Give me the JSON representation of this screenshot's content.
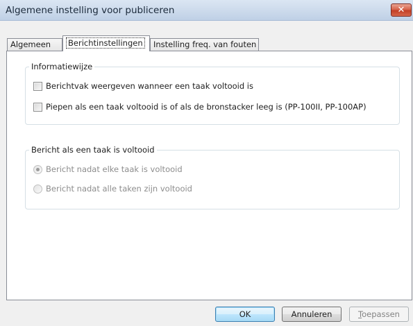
{
  "window": {
    "title": "Algemene instelling voor publiceren",
    "close_glyph": "✕"
  },
  "tabs": [
    {
      "label": "Algemeen",
      "active": false
    },
    {
      "label": "Berichtinstellingen",
      "active": true
    },
    {
      "label": "Instelling freq. van fouten",
      "active": false
    }
  ],
  "group_info": {
    "legend": "Informatiewijze",
    "options": [
      {
        "label": "Berichtvak weergeven wanneer een taak voltooid is",
        "checked": false
      },
      {
        "label": "Piepen als een taak voltooid is of als de bronstacker leeg is (PP-100II, PP-100AP)",
        "checked": false
      }
    ]
  },
  "group_message": {
    "legend": "Bericht als een taak is voltooid",
    "options": [
      {
        "label": "Bericht nadat elke taak is voltooid",
        "selected": true,
        "enabled": false
      },
      {
        "label": "Bericht nadat alle taken zijn voltooid",
        "selected": false,
        "enabled": false
      }
    ]
  },
  "buttons": {
    "ok": "OK",
    "cancel": "Annuleren",
    "apply_mnemonic": "T",
    "apply_rest": "oepassen"
  }
}
